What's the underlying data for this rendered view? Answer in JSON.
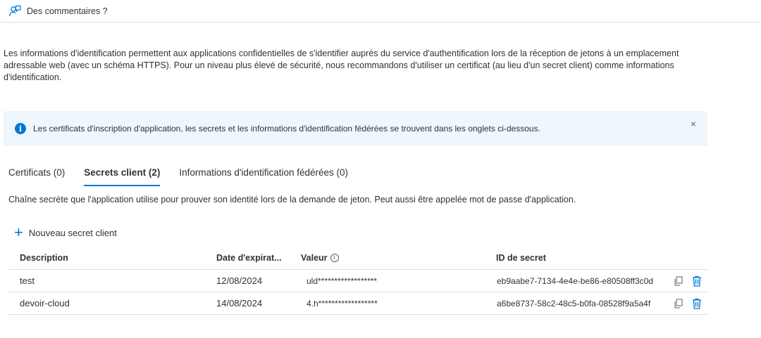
{
  "feedback": {
    "label": "Des commentaires ?",
    "icon": "feedback-icon"
  },
  "intro": "Les informations d'identification permettent aux applications confidentielles de s'identifier auprès du service d'authentification lors de la réception de jetons à un emplacement adressable web (avec un schéma HTTPS). Pour un niveau plus élevé de sécurité, nous recommandons d'utiliser un certificat (au lieu d'un secret client) comme informations d'identification.",
  "infobar": {
    "text": "Les certificats d'inscription d'application, les secrets et les informations d'identification fédérées se trouvent dans les onglets ci-dessous.",
    "icon": "info-icon",
    "close": "×"
  },
  "tabs": [
    {
      "label": "Certificats (0)",
      "active": false
    },
    {
      "label": "Secrets client (2)",
      "active": true
    },
    {
      "label": "Informations d'identification fédérées (0)",
      "active": false
    }
  ],
  "tab_description": "Chaîne secrète que l'application utilise pour prouver son identité lors de la demande de jeton. Peut aussi être appelée mot de passe d'application.",
  "add_button": {
    "label": "Nouveau secret client",
    "icon": "plus-icon"
  },
  "table": {
    "headers": {
      "description": "Description",
      "expiry": "Date d'expirat...",
      "value": "Valeur",
      "secret_id": "ID de secret"
    },
    "rows": [
      {
        "description": "test",
        "expiry": "12/08/2024",
        "value": "uld******************",
        "secret_id": "eb9aabe7-7134-4e4e-be86-e80508ff3c0d"
      },
      {
        "description": "devoir-cloud",
        "expiry": "14/08/2024",
        "value": "4.h******************",
        "secret_id": "a6be8737-58c2-48c5-b0fa-08528f9a5a4f"
      }
    ]
  },
  "colors": {
    "accent": "#0078d4",
    "infobar_bg": "#eff6fc",
    "divider": "#e1dfdd",
    "text": "#323130"
  }
}
